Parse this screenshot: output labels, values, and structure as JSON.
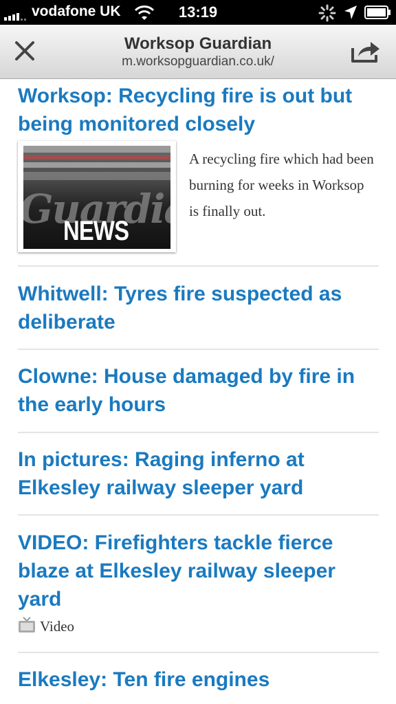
{
  "status_bar": {
    "carrier": "vodafone UK",
    "time": "13:19"
  },
  "nav": {
    "title": "Worksop Guardian",
    "url": "m.worksopguardian.co.uk/"
  },
  "stories": [
    {
      "headline": "Worksop: Recycling fire is out but being monitored closely",
      "thumbnail_label": "NEWS",
      "thumbnail_masthead": "Guardian",
      "summary": "A recycling fire which had been burning for weeks in Worksop is finally out."
    },
    {
      "headline": "Whitwell: Tyres fire suspected as deliberate"
    },
    {
      "headline": "Clowne: House damaged by fire in the early hours"
    },
    {
      "headline": "In pictures: Raging inferno at Elkesley railway sleeper yard"
    },
    {
      "headline": "VIDEO: Firefighters tackle fierce blaze at Elkesley railway sleeper yard",
      "tag": "Video"
    },
    {
      "headline": "Elkesley: Ten fire engines"
    }
  ],
  "colors": {
    "headline": "#1a7ac0",
    "status_bar": "#000000",
    "divider": "#e4e4e4"
  }
}
